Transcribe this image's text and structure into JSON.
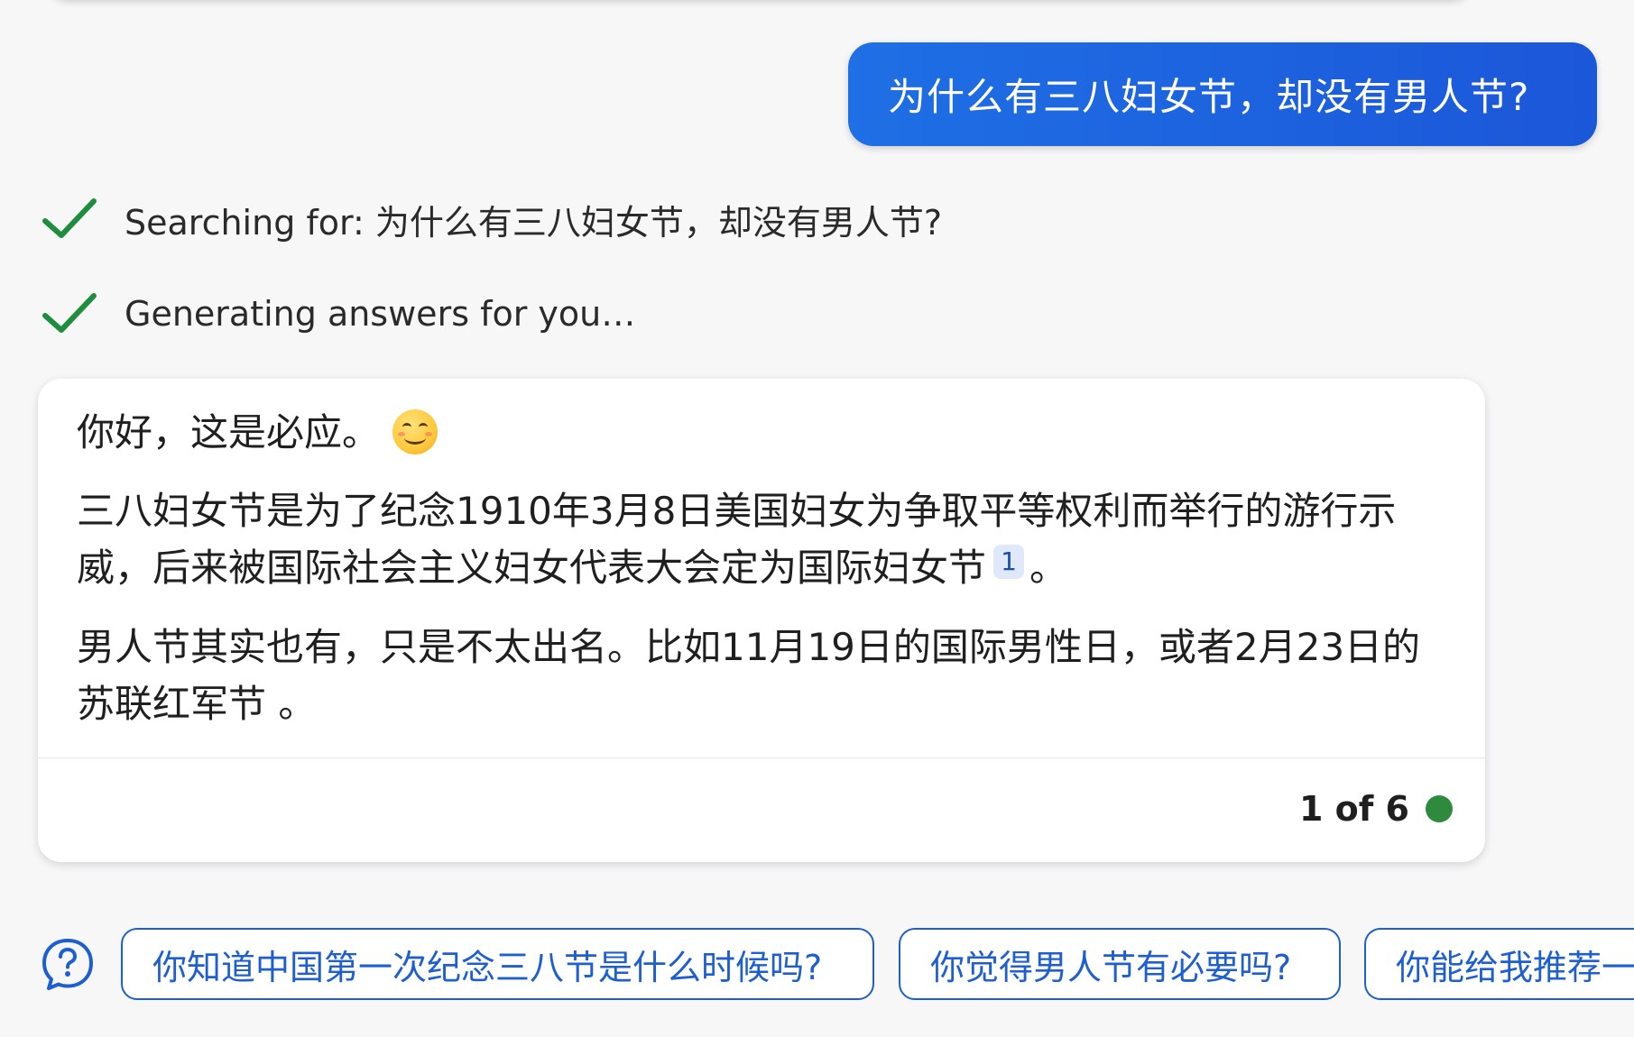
{
  "conversation": {
    "user_message": "为什么有三八妇女节，却没有男人节?",
    "status_steps": [
      {
        "label": "Searching for: 为什么有三八妇女节，却没有男人节?",
        "icon": "check-icon",
        "state": "done"
      },
      {
        "label": "Generating answers for you…",
        "icon": "check-icon",
        "state": "done"
      }
    ],
    "answer": {
      "greeting": "你好，这是必应。",
      "greeting_emoji": "smiling-face-icon",
      "paragraph1": "三八妇女节是为了纪念1910年3月8日美国妇女为争取平等权利而举行的游行示威，后来被国际社会主义妇女代表大会定为国际妇女节",
      "paragraph1_citation": "1",
      "paragraph1_end": "。",
      "paragraph2": "男人节其实也有，只是不太出名。比如11月19日的国际男性日，或者2月23日的苏联红军节 。",
      "page_count": "1 of 6",
      "status_dot_color": "#2e8b3e"
    },
    "suggestions": [
      "你知道中国第一次纪念三八节是什么时候吗?",
      "你觉得男人节有必要吗?",
      "你能给我推荐一"
    ]
  },
  "colors": {
    "user_bubble": "#1f6fe5",
    "check": "#1e8e3e",
    "chip_border": "#1d5fd1",
    "background": "#f7f7f8"
  }
}
